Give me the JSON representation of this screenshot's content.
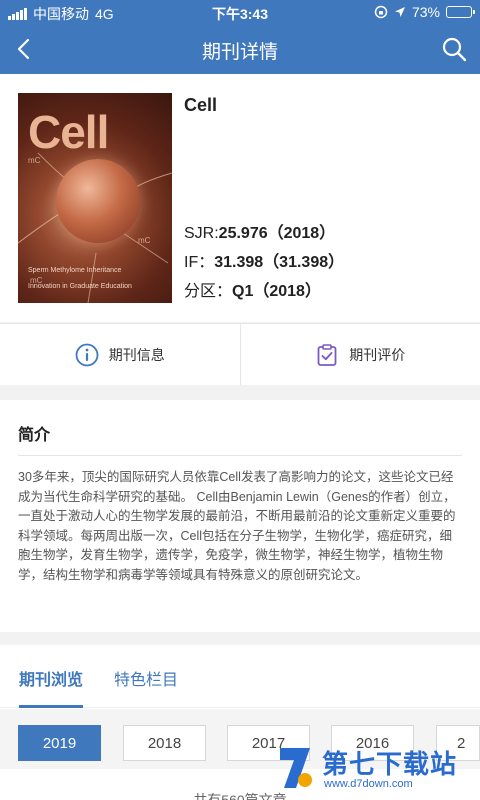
{
  "status_bar": {
    "carrier": "中国移动",
    "network": "4G",
    "time": "下午3:43",
    "battery": "73%",
    "battery_level": 0.73
  },
  "nav": {
    "title": "期刊详情"
  },
  "journal": {
    "name": "Cell",
    "cover": {
      "logo": "Cell",
      "caption1": "Sperm Methylome Inheritance",
      "caption2": "Innovation in Graduate Education"
    },
    "sjr_label": "SJR:",
    "sjr_value": "25.976（2018）",
    "if_label": "IF：",
    "if_value": "31.398（31.398）",
    "zone_label": "分区：",
    "zone_value": "Q1（2018）"
  },
  "actions": {
    "info_label": "期刊信息",
    "review_label": "期刊评价"
  },
  "intro": {
    "heading": "简介",
    "text": "30多年来，顶尖的国际研究人员依靠Cell发表了高影响力的论文，这些论文已经成为当代生命科学研究的基础。 Cell由Benjamin Lewin（Genes的作者）创立，一直处于激动人心的生物学发展的最前沿，不断用最前沿的论文重新定义重要的科学领域。每两周出版一次，Cell包括在分子生物学，生物化学，癌症研究，细胞生物学，发育生物学，遗传学，免疫学，微生物学，神经生物学，植物生物学，结构生物学和病毒学等领域具有特殊意义的原创研究论文。"
  },
  "browse": {
    "tab_browse": "期刊浏览",
    "tab_featured": "特色栏目",
    "years": [
      "2019",
      "2018",
      "2017",
      "2016",
      "2"
    ],
    "total": "共有560篇文章"
  },
  "watermark": {
    "text": "第七下载站",
    "url": "www.d7down.com"
  },
  "colors": {
    "primary": "#3f78bd",
    "accent_purple": "#7b5ac4"
  }
}
